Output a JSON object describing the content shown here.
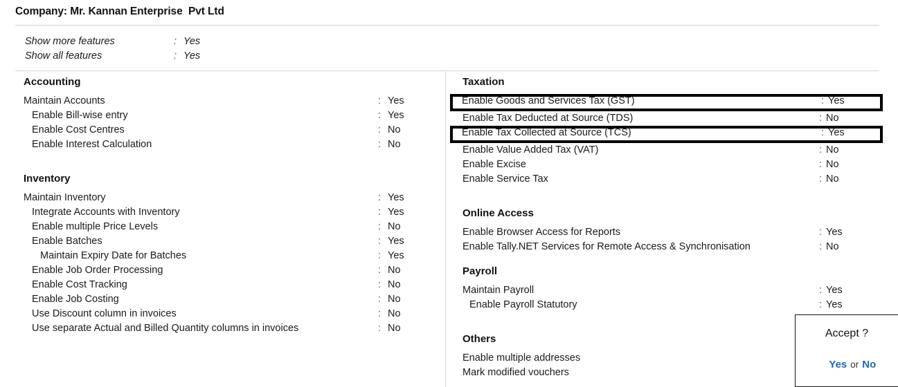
{
  "header": {
    "company_title": "Company: Mr. Kannan Enterprise  Pvt Ltd"
  },
  "show_features": {
    "rows": [
      {
        "label": "Show more features",
        "colon": ":",
        "value": "Yes"
      },
      {
        "label": "Show all features",
        "colon": ":",
        "value": "Yes"
      }
    ]
  },
  "left_column": {
    "sections": [
      {
        "title": "Accounting",
        "rows": [
          {
            "label": "Maintain Accounts",
            "indent": 0,
            "colon": ":",
            "value": "Yes"
          },
          {
            "label": "Enable Bill-wise entry",
            "indent": 1,
            "colon": ":",
            "value": "Yes"
          },
          {
            "label": "Enable Cost Centres",
            "indent": 1,
            "colon": ":",
            "value": "No"
          },
          {
            "label": "Enable Interest Calculation",
            "indent": 1,
            "colon": ":",
            "value": "No"
          }
        ]
      },
      {
        "title": "Inventory",
        "rows": [
          {
            "label": "Maintain Inventory",
            "indent": 0,
            "colon": ":",
            "value": "Yes"
          },
          {
            "label": "Integrate Accounts with Inventory",
            "indent": 1,
            "colon": ":",
            "value": "Yes"
          },
          {
            "label": "Enable multiple Price Levels",
            "indent": 1,
            "colon": ":",
            "value": "No"
          },
          {
            "label": "Enable Batches",
            "indent": 1,
            "colon": ":",
            "value": "Yes"
          },
          {
            "label": "Maintain Expiry Date for Batches",
            "indent": 2,
            "colon": ":",
            "value": "Yes"
          },
          {
            "label": "Enable Job Order Processing",
            "indent": 1,
            "colon": ":",
            "value": "No"
          },
          {
            "label": "Enable Cost Tracking",
            "indent": 1,
            "colon": ":",
            "value": "No"
          },
          {
            "label": "Enable Job Costing",
            "indent": 1,
            "colon": ":",
            "value": "No"
          },
          {
            "label": "Use Discount column in invoices",
            "indent": 1,
            "colon": ":",
            "value": "No"
          },
          {
            "label": "Use separate Actual and Billed Quantity columns in invoices",
            "indent": 1,
            "colon": ":",
            "value": "No"
          }
        ]
      }
    ]
  },
  "right_column": {
    "sections": [
      {
        "title": "Taxation",
        "rows": [
          {
            "label": "Enable Goods and Services Tax (GST)",
            "indent": 0,
            "colon": ":",
            "value": "Yes",
            "highlighted": true
          },
          {
            "label": "Enable Tax Deducted at Source (TDS)",
            "indent": 0,
            "colon": ":",
            "value": "No",
            "highlighted": false
          },
          {
            "label": "Enable Tax Collected at Source (TCS)",
            "indent": 0,
            "colon": ":",
            "value": "Yes",
            "highlighted": true
          },
          {
            "label": "Enable Value Added Tax (VAT)",
            "indent": 0,
            "colon": ":",
            "value": "No",
            "highlighted": false
          },
          {
            "label": "Enable Excise",
            "indent": 0,
            "colon": ":",
            "value": "No",
            "highlighted": false
          },
          {
            "label": "Enable Service Tax",
            "indent": 0,
            "colon": ":",
            "value": "No",
            "highlighted": false
          }
        ]
      },
      {
        "title": "Online Access",
        "rows": [
          {
            "label": "Enable Browser Access for Reports",
            "indent": 0,
            "colon": ":",
            "value": "Yes"
          },
          {
            "label": "Enable Tally.NET Services for Remote Access & Synchronisation",
            "indent": 0,
            "colon": ":",
            "value": "No"
          }
        ]
      },
      {
        "title": "Payroll",
        "rows": [
          {
            "label": "Maintain Payroll",
            "indent": 0,
            "colon": ":",
            "value": "Yes"
          },
          {
            "label": "Enable Payroll Statutory",
            "indent": 1,
            "colon": ":",
            "value": "Yes"
          }
        ]
      },
      {
        "title": "Others",
        "rows": [
          {
            "label": "Enable multiple addresses",
            "indent": 0,
            "colon": "",
            "value": ""
          },
          {
            "label": "Mark modified vouchers",
            "indent": 0,
            "colon": "",
            "value": ""
          }
        ]
      }
    ]
  },
  "accept_dialog": {
    "question": "Accept ?",
    "yes_label": "Yes",
    "or_label": "or",
    "no_label": "No",
    "accent_color": "#2166ac"
  }
}
